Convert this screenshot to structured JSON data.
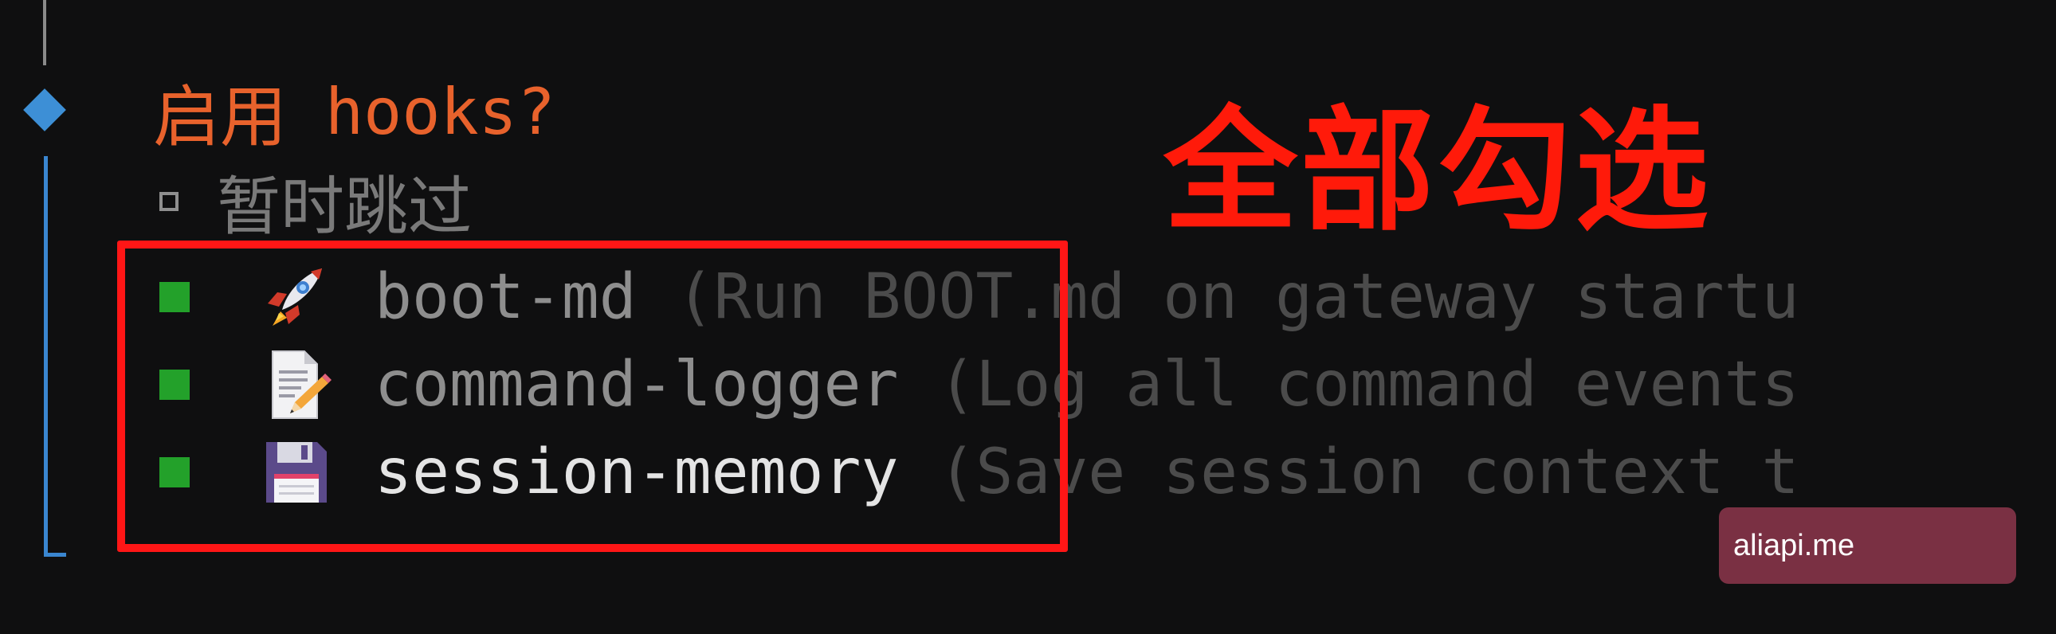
{
  "prompt": {
    "question_zh": "启用",
    "question_en": "hooks?"
  },
  "skip_option": {
    "label": "暂时跳过",
    "checked": false
  },
  "hooks": [
    {
      "icon": "rocket-icon",
      "name": "boot-md",
      "description": "(Run BOOT.md on gateway startu",
      "checked": true
    },
    {
      "icon": "memo-icon",
      "name": "command-logger",
      "description": "(Log all command events",
      "checked": true
    },
    {
      "icon": "floppy-disk-icon",
      "name": "session-memory",
      "description": "(Save session context t",
      "checked": true
    }
  ],
  "annotation": {
    "text": "全部勾选"
  },
  "watermark": {
    "text": "aliapi.me"
  },
  "colors": {
    "background": "#0f0f10",
    "question": "#e8622c",
    "checkbox_checked": "#23a12a",
    "rail": "#3a86d0",
    "highlight": "#ff1616",
    "annotation": "#ff1a0a",
    "watermark_bg": "#7a3043"
  }
}
